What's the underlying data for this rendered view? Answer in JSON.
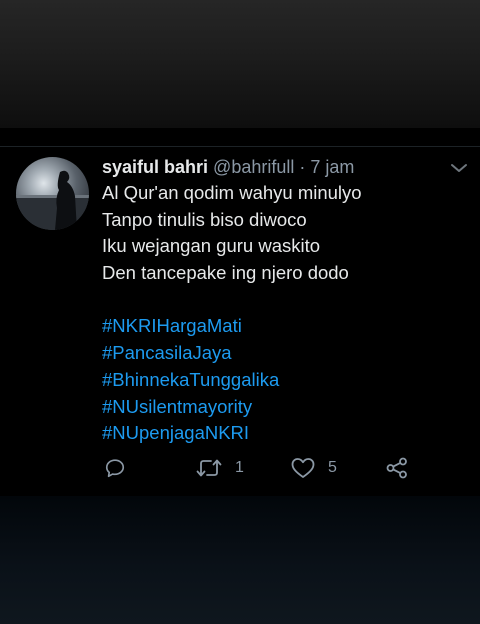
{
  "tweet": {
    "name": "syaiful bahri",
    "handle": "@bahrifull",
    "separator": "·",
    "time": "7 jam",
    "lines": [
      "Al Qur'an qodim wahyu minulyo",
      "Tanpo tinulis biso diwoco",
      "Iku wejangan guru waskito",
      "Den tancepake ing njero dodo"
    ],
    "hashtags": [
      "#NKRIHargaMati",
      "#PancasilaJaya",
      "#BhinnekaTunggalika",
      "#NUsilentmayority",
      "#NUpenjagaNKRI"
    ]
  },
  "actions": {
    "reply_icon": "reply-icon",
    "retweet_icon": "retweet-icon",
    "retweet_count": "1",
    "like_icon": "heart-icon",
    "like_count": "5",
    "share_icon": "share-icon"
  },
  "colors": {
    "background": "#000000",
    "text": "#e7e9ea",
    "muted": "#8b98a5",
    "accent": "#1d9bf0"
  }
}
